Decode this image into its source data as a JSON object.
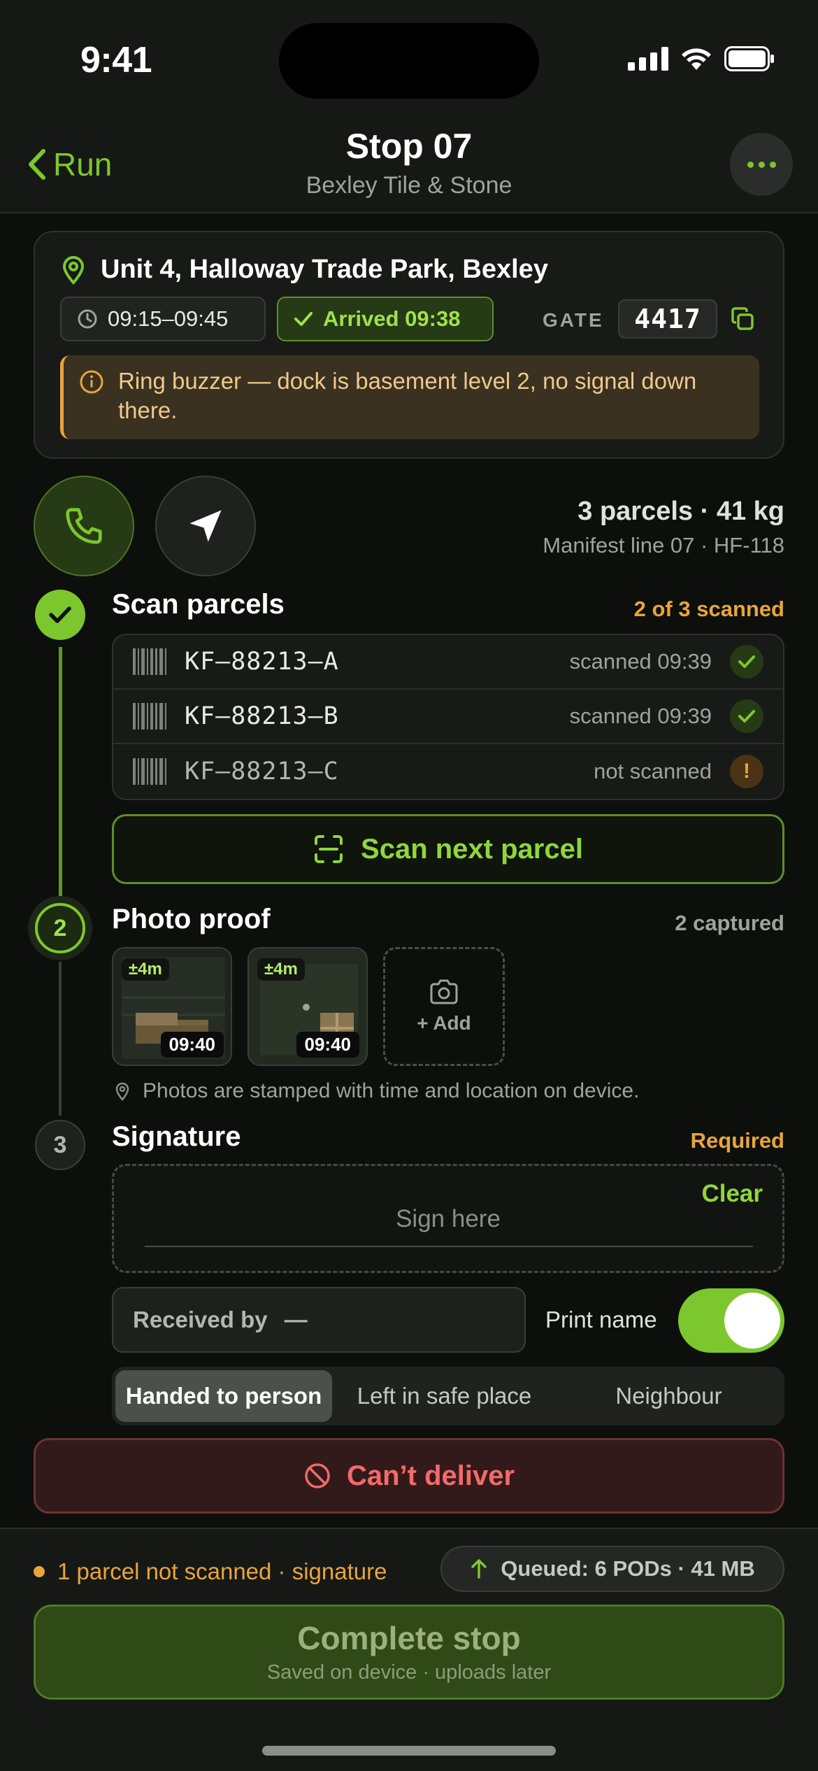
{
  "status_bar": {
    "time": "9:41"
  },
  "nav": {
    "back_label": "Run",
    "title": "Stop 07",
    "subtitle": "Bexley Tile & Stone"
  },
  "address_card": {
    "address": "Unit 4, Halloway Trade Park, Bexley",
    "time_window": "09:15–09:45",
    "arrived": "Arrived 09:38",
    "gate_label": "GATE",
    "gate_code": "4417",
    "note": "Ring buzzer — dock is basement level 2, no signal down there."
  },
  "summary": {
    "parcels": "3 parcels · 41 kg",
    "manifest": "Manifest line 07 · HF-118"
  },
  "steps": {
    "scan": {
      "title": "Scan parcels",
      "meta": "2 of 3 scanned",
      "parcels": [
        {
          "code": "KF–88213–A",
          "status": "scanned 09:39",
          "state": "ok"
        },
        {
          "code": "KF–88213–B",
          "status": "scanned 09:39",
          "state": "ok"
        },
        {
          "code": "KF–88213–C",
          "status": "not scanned",
          "state": "warn",
          "warn_glyph": "!"
        }
      ],
      "scan_button": "Scan next parcel"
    },
    "photo": {
      "number": "2",
      "title": "Photo proof",
      "meta": "2 captured",
      "photos": [
        {
          "accuracy": "±4m",
          "time": "09:40"
        },
        {
          "accuracy": "±4m",
          "time": "09:40"
        }
      ],
      "add_label": "+ Add",
      "note": "Photos are stamped with time and location on device."
    },
    "signature": {
      "number": "3",
      "title": "Signature",
      "meta": "Required",
      "clear_label": "Clear",
      "placeholder": "Sign here",
      "received_by_label": "Received by",
      "received_by_value": "—",
      "print_name_label": "Print name",
      "print_name_on": true,
      "handover_options": [
        "Handed to person",
        "Left in safe place",
        "Neighbour"
      ],
      "handover_selected": "Handed to person"
    }
  },
  "cant_deliver_label": "Can’t deliver",
  "footer": {
    "warning": "1 parcel not scanned · signature",
    "queue": "Queued: 6 PODs · 41 MB",
    "complete_title": "Complete stop",
    "complete_sub": "Saved on device · uploads later"
  },
  "colors": {
    "accent": "#7cc72d",
    "warning": "#e9a53b",
    "danger": "#f26a6a",
    "background": "#0d0f0d"
  }
}
